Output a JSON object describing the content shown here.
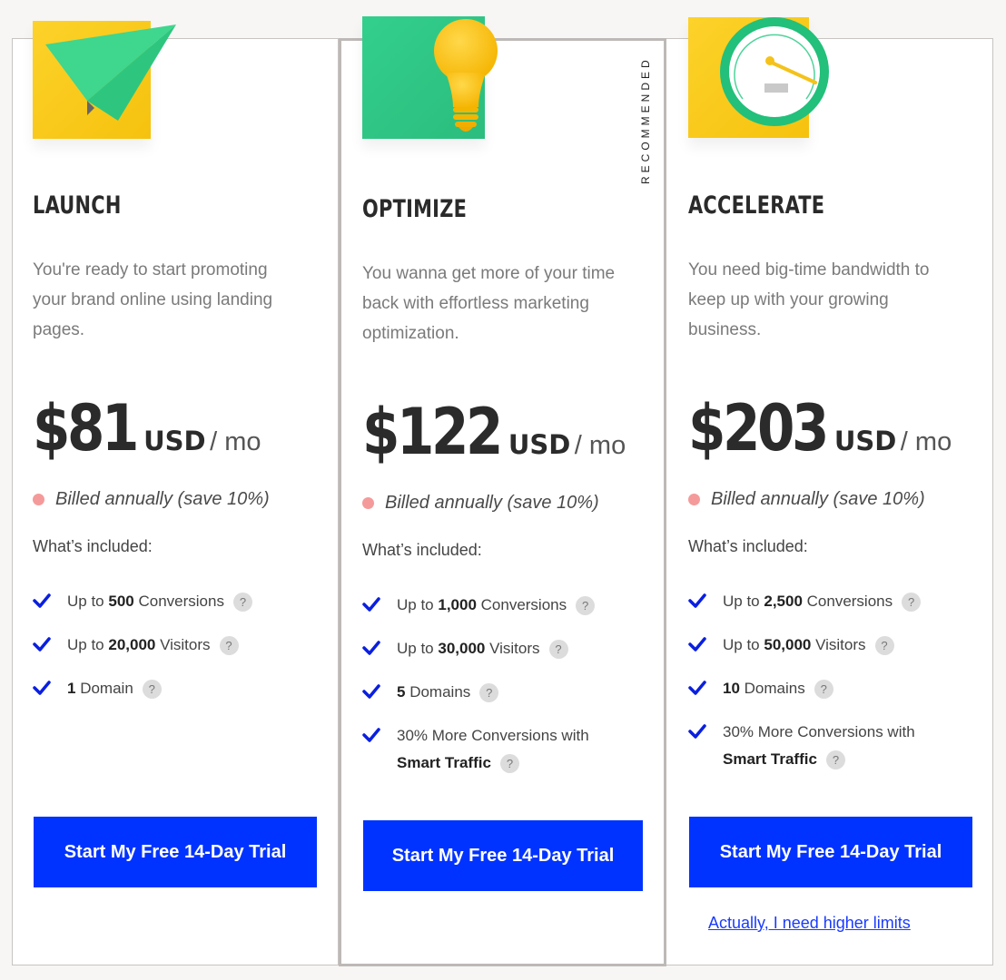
{
  "badge": "RECOMMENDED",
  "plans": [
    {
      "name": "LAUNCH",
      "illustration": "paper-plane-icon",
      "description": "You're ready to start promoting your brand online using landing pages.",
      "price": "$81",
      "currency": "USD",
      "period": "/ mo",
      "billing": "Billed annually (save 10%)",
      "included_label": "What’s included:",
      "features": [
        {
          "pre": "Up to ",
          "bold": "500",
          "post": " Conversions"
        },
        {
          "pre": "Up to ",
          "bold": "20,000",
          "post": " Visitors"
        },
        {
          "pre": "",
          "bold": "1",
          "post": " Domain"
        }
      ],
      "cta": "Start My Free 14-Day Trial"
    },
    {
      "name": "OPTIMIZE",
      "illustration": "lightbulb-icon",
      "description": "You wanna get more of your time back with effortless marketing optimization.",
      "price": "$122",
      "currency": "USD",
      "period": "/ mo",
      "billing": "Billed annually (save 10%)",
      "included_label": "What’s included:",
      "features": [
        {
          "pre": "Up to ",
          "bold": "1,000",
          "post": " Conversions"
        },
        {
          "pre": "Up to ",
          "bold": "30,000",
          "post": " Visitors"
        },
        {
          "pre": "",
          "bold": "5",
          "post": " Domains"
        },
        {
          "pre": "30% More Conversions with ",
          "bold": "Smart Traffic",
          "post": ""
        }
      ],
      "cta": "Start My Free 14-Day Trial",
      "recommended": true
    },
    {
      "name": "ACCELERATE",
      "illustration": "speedometer-icon",
      "description": "You need big-time bandwidth to keep up with your growing business.",
      "price": "$203",
      "currency": "USD",
      "period": "/ mo",
      "billing": "Billed annually (save 10%)",
      "included_label": "What’s included:",
      "features": [
        {
          "pre": "Up to ",
          "bold": "2,500",
          "post": " Conversions"
        },
        {
          "pre": "Up to ",
          "bold": "50,000",
          "post": " Visitors"
        },
        {
          "pre": "",
          "bold": "10",
          "post": " Domains"
        },
        {
          "pre": "30% More Conversions with ",
          "bold": "Smart Traffic",
          "post": ""
        }
      ],
      "cta": "Start My Free 14-Day Trial",
      "link": "Actually, I need higher limits"
    }
  ],
  "colors": {
    "cta": "#0033ff",
    "accent_green": "#2fcf8a",
    "accent_yellow": "#fcd12a",
    "dot": "#f59a9a",
    "check": "#0a1fe0"
  }
}
